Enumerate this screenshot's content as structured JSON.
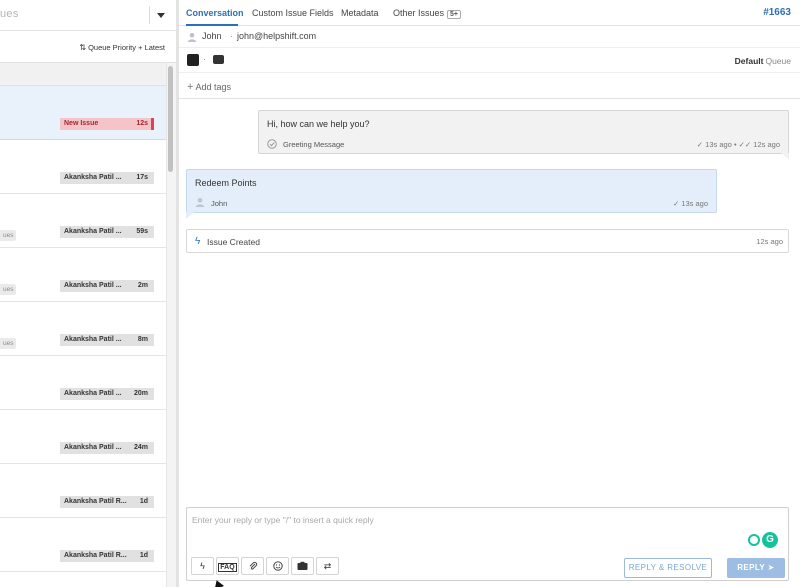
{
  "left_pane": {
    "search_text": "ues",
    "sort_label": "Queue Priority + Latest",
    "rows": [
      {
        "tag": "",
        "assignee": "New Issue",
        "time": "12s",
        "kind": "new"
      },
      {
        "tag": "",
        "assignee": "Akanksha Patil ...",
        "time": "17s",
        "kind": "normal"
      },
      {
        "tag": "ues",
        "assignee": "Akanksha Patil ...",
        "time": "59s",
        "kind": "normal"
      },
      {
        "tag": "ues",
        "assignee": "Akanksha Patil ...",
        "time": "2m",
        "kind": "normal"
      },
      {
        "tag": "ues",
        "assignee": "Akanksha Patil ...",
        "time": "8m",
        "kind": "normal"
      },
      {
        "tag": "",
        "assignee": "Akanksha Patil ...",
        "time": "20m",
        "kind": "normal"
      },
      {
        "tag": "",
        "assignee": "Akanksha Patil ...",
        "time": "24m",
        "kind": "normal"
      },
      {
        "tag": "",
        "assignee": "Akanksha Patil R...",
        "time": "1d",
        "kind": "normal"
      },
      {
        "tag": "",
        "assignee": "Akanksha Patil R...",
        "time": "1d",
        "kind": "normal"
      }
    ]
  },
  "tabs": [
    {
      "label": "Conversation",
      "active": true
    },
    {
      "label": "Custom Issue Fields",
      "active": false
    },
    {
      "label": "Metadata",
      "active": false
    },
    {
      "label": "Other Issues",
      "active": false,
      "badge": "5+"
    }
  ],
  "issue_id": "#1663",
  "user": {
    "name": "John",
    "separator": "·",
    "email": "john@helpshift.com"
  },
  "meta": {
    "separator": "·",
    "queue_name": "Default",
    "queue_label": "Queue"
  },
  "tags": {
    "add_label": "Add tags"
  },
  "messages": {
    "agent": {
      "text": "Hi, how can we help you?",
      "foot_label": "Greeting Message",
      "time": "✓ 13s ago • ✓✓ 12s ago"
    },
    "user": {
      "text": "Redeem Points",
      "foot_label": "John",
      "time": "✓ 13s ago"
    },
    "event": {
      "label": "Issue Created",
      "time": "12s ago"
    }
  },
  "composer": {
    "placeholder": "Enter your reply or type \"/\" to insert a quick reply",
    "grammarly_letter": "G",
    "faq_label": "FAQ",
    "resolve_label": "REPLY & RESOLVE",
    "reply_label": "REPLY ➤"
  },
  "colors": {
    "accent": "#2f6fb6",
    "new_issue_bg": "#f4c4c9",
    "new_issue_bar": "#e0404f",
    "reply_btn": "#9dbde3",
    "grammarly": "#15c39a"
  }
}
